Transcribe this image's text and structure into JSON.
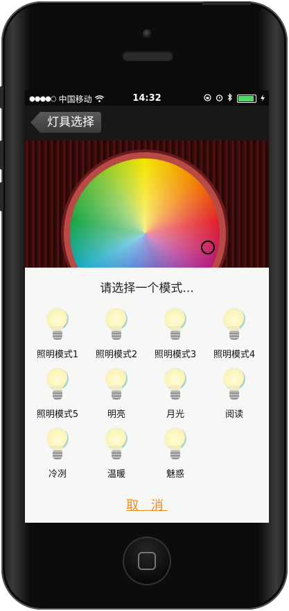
{
  "status_bar": {
    "signal_dots": "●●●●○",
    "carrier": "中国移动",
    "time": "14:32",
    "battery_level": 0.85
  },
  "nav": {
    "back_label": "灯具选择"
  },
  "sheet": {
    "title": "请选择一个模式...",
    "cancel_label": "取 消",
    "modes": [
      {
        "label": "照明模式1"
      },
      {
        "label": "照明模式2"
      },
      {
        "label": "照明模式3"
      },
      {
        "label": "照明模式4"
      },
      {
        "label": "照明模式5"
      },
      {
        "label": "明亮"
      },
      {
        "label": "月光"
      },
      {
        "label": "阅读"
      },
      {
        "label": "冷冽"
      },
      {
        "label": "温暖"
      },
      {
        "label": "魅惑"
      }
    ]
  },
  "icons": {
    "wifi": "wifi-icon",
    "alarm": "alarm-icon",
    "bluetooth": "bluetooth-icon",
    "lock_rotation": "orientation-lock-icon",
    "battery": "battery-icon",
    "bulb": "light-bulb-icon"
  },
  "colors": {
    "accent": "#f08a1c",
    "sheet_bg": "#f7f7f5",
    "battery": "#4cd964"
  }
}
